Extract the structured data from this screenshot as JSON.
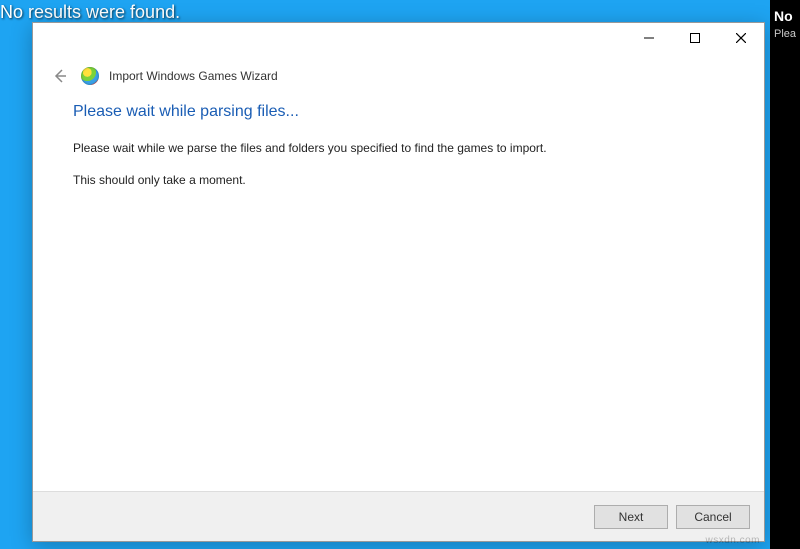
{
  "desktop": {
    "message": "No results were found."
  },
  "right_panel": {
    "title": "No",
    "subtitle": "Plea"
  },
  "dialog": {
    "wizard_title": "Import Windows Games Wizard",
    "headline": "Please wait while parsing files...",
    "description": "Please wait while we parse the files and folders you specified to find the games to import.",
    "note": "This should only take a moment.",
    "buttons": {
      "next": "Next",
      "cancel": "Cancel"
    }
  },
  "watermark": "wsxdn.com"
}
